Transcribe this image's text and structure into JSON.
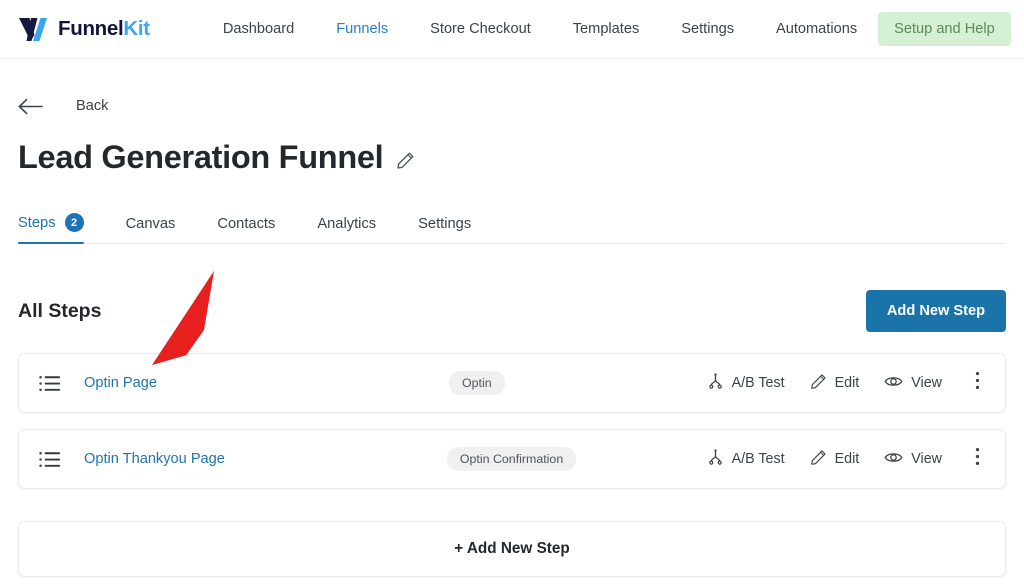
{
  "topbar": {
    "brand": {
      "logo_icon": "funnelkit-v-logo-icon",
      "text_dark": "Funnel",
      "text_blue": "Kit",
      "color_dark": "#12133a",
      "color_blue": "#3aa6ee"
    },
    "nav": [
      {
        "label": "Dashboard",
        "active": false
      },
      {
        "label": "Funnels",
        "active": true
      },
      {
        "label": "Store Checkout",
        "active": false
      },
      {
        "label": "Templates",
        "active": false
      },
      {
        "label": "Settings",
        "active": false
      },
      {
        "label": "Automations",
        "active": false
      }
    ],
    "setup_help": {
      "label": "Setup and Help",
      "bg": "#d6f0d4",
      "fg": "#5d8a5a"
    },
    "active_color": "#2a7fc9"
  },
  "back": {
    "icon": "arrow-left-icon",
    "label": "Back"
  },
  "title": {
    "text": "Lead Generation Funnel",
    "edit_icon": "pencil-icon"
  },
  "tabs": [
    {
      "label": "Steps",
      "badge": "2",
      "active": true
    },
    {
      "label": "Canvas",
      "badge": "",
      "active": false
    },
    {
      "label": "Contacts",
      "badge": "",
      "active": false
    },
    {
      "label": "Analytics",
      "badge": "",
      "active": false
    },
    {
      "label": "Settings",
      "badge": "",
      "active": false
    }
  ],
  "tab_accent_color": "#1d74b5",
  "steps_section": {
    "heading": "All Steps",
    "add_button_label": "Add New Step",
    "add_button_color": "#1b74a8",
    "add_ghost_label": "+ Add New Step"
  },
  "steps": [
    {
      "drag_icon": "list-drag-handle-icon",
      "name": "Optin Page",
      "type": "Optin",
      "actions": [
        {
          "icon": "ab-split-icon",
          "label": "A/B Test"
        },
        {
          "icon": "pencil-icon",
          "label": "Edit"
        },
        {
          "icon": "eye-icon",
          "label": "View"
        }
      ],
      "menu_icon": "vertical-dots-icon"
    },
    {
      "drag_icon": "list-drag-handle-icon",
      "name": "Optin Thankyou Page",
      "type": "Optin Confirmation",
      "actions": [
        {
          "icon": "ab-split-icon",
          "label": "A/B Test"
        },
        {
          "icon": "pencil-icon",
          "label": "Edit"
        },
        {
          "icon": "eye-icon",
          "label": "View"
        }
      ],
      "menu_icon": "vertical-dots-icon"
    }
  ],
  "annotation": {
    "arrow_icon": "red-pointer-arrow-icon",
    "color": "#e81f1f"
  },
  "link_color": "#2173b0"
}
